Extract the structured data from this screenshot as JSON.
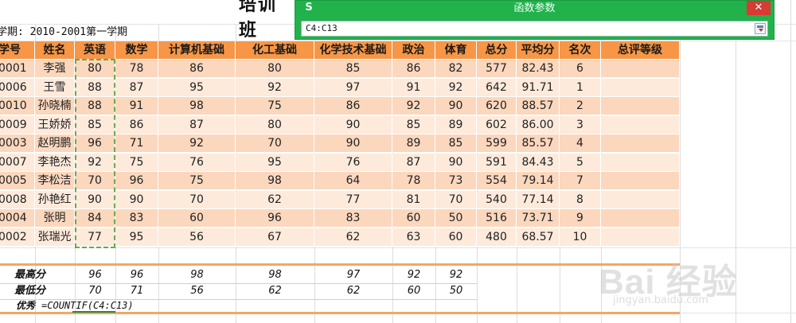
{
  "sheet": {
    "title": "培训班",
    "semester": "学期: 2010-2001第一学期",
    "headers": [
      "学号",
      "姓名",
      "英语",
      "数学",
      "计算机基础",
      "化工基础",
      "化学技术基础",
      "政治",
      "体育",
      "总分",
      "平均分",
      "名次",
      "总评等级"
    ],
    "rows": [
      [
        "0001",
        "李强",
        "80",
        "78",
        "86",
        "80",
        "85",
        "86",
        "82",
        "577",
        "82.43",
        "6",
        ""
      ],
      [
        "0006",
        "王雪",
        "88",
        "87",
        "95",
        "92",
        "97",
        "91",
        "92",
        "642",
        "91.71",
        "1",
        ""
      ],
      [
        "0010",
        "孙晓楠",
        "88",
        "91",
        "98",
        "75",
        "86",
        "92",
        "90",
        "620",
        "88.57",
        "2",
        ""
      ],
      [
        "0009",
        "王娇娇",
        "85",
        "86",
        "87",
        "80",
        "90",
        "85",
        "89",
        "602",
        "86.00",
        "3",
        ""
      ],
      [
        "0003",
        "赵明鹏",
        "96",
        "71",
        "92",
        "70",
        "90",
        "89",
        "85",
        "599",
        "85.57",
        "4",
        ""
      ],
      [
        "0007",
        "李艳杰",
        "92",
        "75",
        "76",
        "95",
        "76",
        "87",
        "90",
        "591",
        "84.43",
        "5",
        ""
      ],
      [
        "0005",
        "李松洁",
        "70",
        "96",
        "75",
        "98",
        "64",
        "78",
        "73",
        "554",
        "79.14",
        "7",
        ""
      ],
      [
        "0008",
        "孙艳红",
        "90",
        "90",
        "70",
        "62",
        "77",
        "81",
        "70",
        "540",
        "77.14",
        "8",
        ""
      ],
      [
        "0004",
        "张明",
        "84",
        "83",
        "60",
        "96",
        "83",
        "60",
        "50",
        "516",
        "73.71",
        "9",
        ""
      ],
      [
        "0002",
        "张瑞光",
        "77",
        "95",
        "56",
        "67",
        "62",
        "63",
        "60",
        "480",
        "68.57",
        "10",
        ""
      ]
    ],
    "stats": [
      {
        "label": "最高分",
        "values": [
          "96",
          "96",
          "98",
          "98",
          "97",
          "92",
          "92"
        ]
      },
      {
        "label": "最低分",
        "values": [
          "70",
          "71",
          "56",
          "62",
          "62",
          "60",
          "50"
        ]
      }
    ],
    "excellent_label": "优秀",
    "formula": "=COUNTIF(C4:C13)"
  },
  "dialog": {
    "title": "函数参数",
    "logo": "S",
    "close": "✕",
    "input_value": "C4:C13",
    "collapse_icon": "collapse-dialog-icon"
  },
  "watermark": {
    "brand": "Bai 经验",
    "url": "jingyan.baidu.com"
  },
  "colors": {
    "header": "#f79646",
    "row_dark": "#fbd7bd",
    "row_light": "#fdeadb",
    "dialog": "#21b24c",
    "selection": "#6aa84f"
  }
}
